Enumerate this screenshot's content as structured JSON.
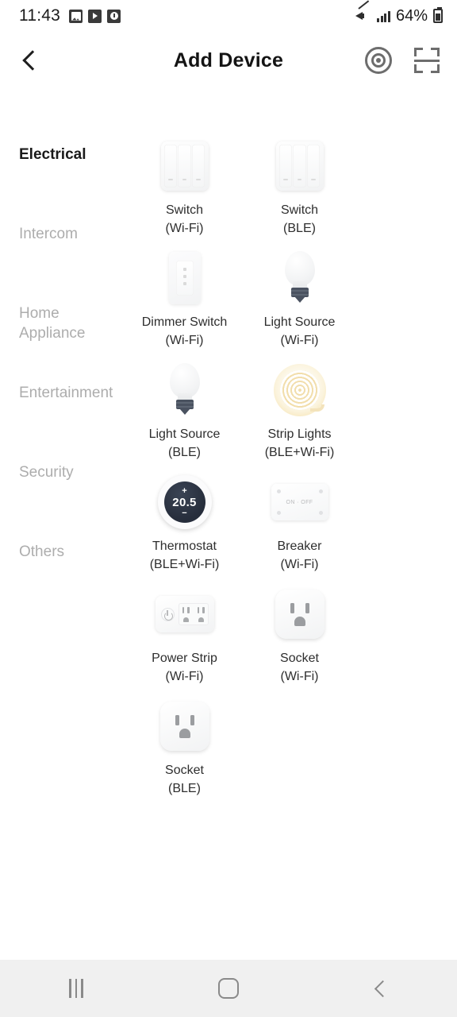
{
  "status_bar": {
    "time": "11:43",
    "battery_percent": "64%",
    "notification_icons": [
      "gallery-icon",
      "play-video-icon",
      "clock-icon"
    ],
    "right_icons": [
      "mute-icon",
      "signal-icon",
      "battery-icon"
    ]
  },
  "header": {
    "back_label": "‹",
    "title": "Add Device",
    "action_icons": [
      "radar-scan-icon",
      "qr-scan-icon"
    ]
  },
  "sidebar": {
    "items": [
      {
        "label": "Electrical",
        "active": true
      },
      {
        "label": "Intercom",
        "active": false
      },
      {
        "label": "Home Appliance",
        "active": false
      },
      {
        "label": "Entertainment",
        "active": false
      },
      {
        "label": "Security",
        "active": false
      },
      {
        "label": "Others",
        "active": false
      }
    ]
  },
  "devices": [
    {
      "name": "Switch",
      "protocol": "(Wi-Fi)",
      "icon": "wall-switch-icon"
    },
    {
      "name": "Switch",
      "protocol": "(BLE)",
      "icon": "wall-switch-icon"
    },
    {
      "name": "Dimmer Switch",
      "protocol": "(Wi-Fi)",
      "icon": "dimmer-switch-icon"
    },
    {
      "name": "Light Source",
      "protocol": "(Wi-Fi)",
      "icon": "light-bulb-icon"
    },
    {
      "name": "Light Source",
      "protocol": "(BLE)",
      "icon": "light-bulb-icon"
    },
    {
      "name": "Strip Lights",
      "protocol": "(BLE+Wi-Fi)",
      "icon": "strip-light-icon"
    },
    {
      "name": "Thermostat",
      "protocol": "(BLE+Wi-Fi)",
      "icon": "thermostat-icon"
    },
    {
      "name": "Breaker",
      "protocol": "(Wi-Fi)",
      "icon": "breaker-icon"
    },
    {
      "name": "Power Strip",
      "protocol": "(Wi-Fi)",
      "icon": "power-strip-icon"
    },
    {
      "name": "Socket",
      "protocol": "(Wi-Fi)",
      "icon": "socket-icon"
    },
    {
      "name": "Socket",
      "protocol": "(BLE)",
      "icon": "socket-icon"
    }
  ],
  "thermostat_icon": {
    "plus": "+",
    "temperature": "20.5",
    "minus": "−"
  },
  "breaker_icon": {
    "text": "ON · OFF"
  },
  "nav_bar": {
    "recents": "recents-icon",
    "home": "home-icon",
    "back": "back-icon"
  },
  "colors": {
    "background": "#ffffff",
    "title": "#141414",
    "active_category": "#1a1a1a",
    "inactive_category": "#adadad",
    "label": "#2e2e2e",
    "thermostat_dial": "#262d3b",
    "nav_bar": "#f0f0f0"
  }
}
